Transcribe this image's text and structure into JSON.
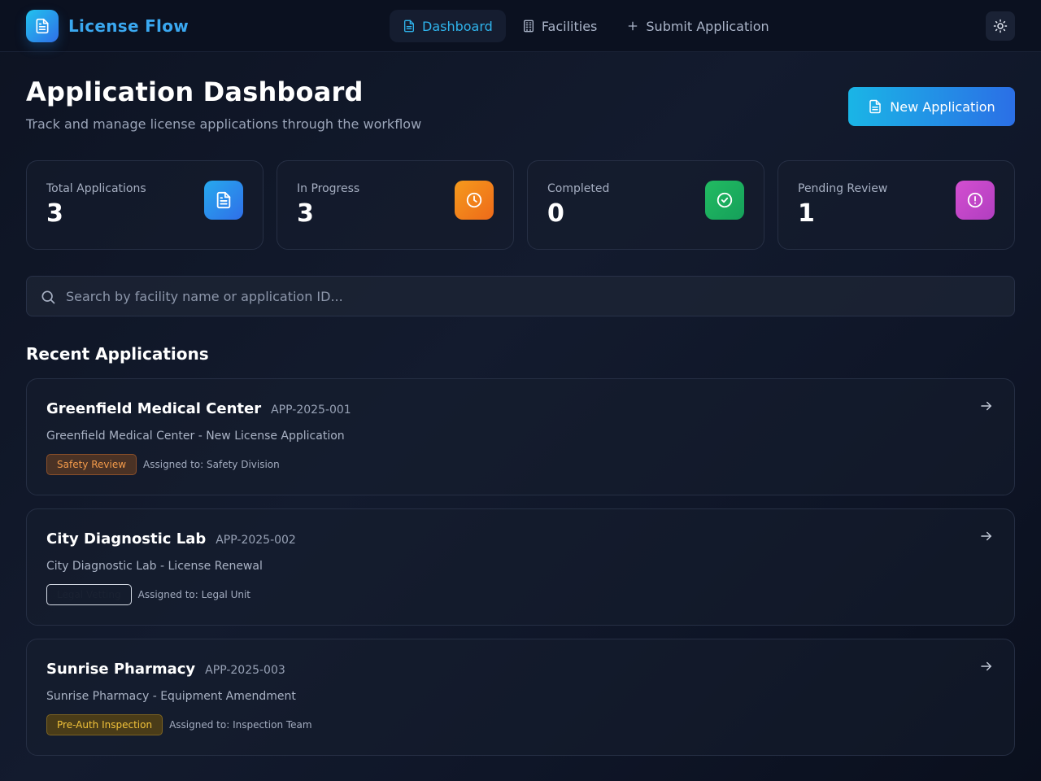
{
  "app": {
    "name": "License Flow"
  },
  "nav": {
    "items": [
      {
        "label": "Dashboard",
        "icon": "document-icon",
        "active": true
      },
      {
        "label": "Facilities",
        "icon": "building-icon",
        "active": false
      },
      {
        "label": "Submit Application",
        "icon": "plus-icon",
        "active": false
      }
    ]
  },
  "header": {
    "theme_toggle_icon": "sun-icon"
  },
  "page": {
    "title": "Application Dashboard",
    "subtitle": "Track and manage license applications through the workflow",
    "new_button_label": "New Application"
  },
  "stats": [
    {
      "label": "Total Applications",
      "value": "3",
      "icon": "document-icon",
      "color": "#2e8ae8"
    },
    {
      "label": "In Progress",
      "value": "3",
      "icon": "clock-icon",
      "color": "#f07c1c"
    },
    {
      "label": "Completed",
      "value": "0",
      "icon": "check-circle-icon",
      "color": "#1fae5c"
    },
    {
      "label": "Pending Review",
      "value": "1",
      "icon": "alert-circle-icon",
      "color": "#c547c8"
    }
  ],
  "search": {
    "placeholder": "Search by facility name or application ID...",
    "value": ""
  },
  "recent": {
    "title": "Recent Applications",
    "items": [
      {
        "name": "Greenfield Medical Center",
        "id": "APP-2025-001",
        "description": "Greenfield Medical Center - New License Application",
        "status": "Safety Review",
        "assigned": "Assigned to: Safety Division"
      },
      {
        "name": "City Diagnostic Lab",
        "id": "APP-2025-002",
        "description": "City Diagnostic Lab - License Renewal",
        "status": "Legal Vetting",
        "assigned": "Assigned to: Legal Unit"
      },
      {
        "name": "Sunrise Pharmacy",
        "id": "APP-2025-003",
        "description": "Sunrise Pharmacy - Equipment Amendment",
        "status": "Pre-Auth Inspection",
        "assigned": "Assigned to: Inspection Team"
      }
    ]
  },
  "colors": {
    "accent": "#2fb4ec",
    "background": "#0d1322",
    "safety_badge": "#f29a4a",
    "preauth_badge": "#f1c23a"
  }
}
